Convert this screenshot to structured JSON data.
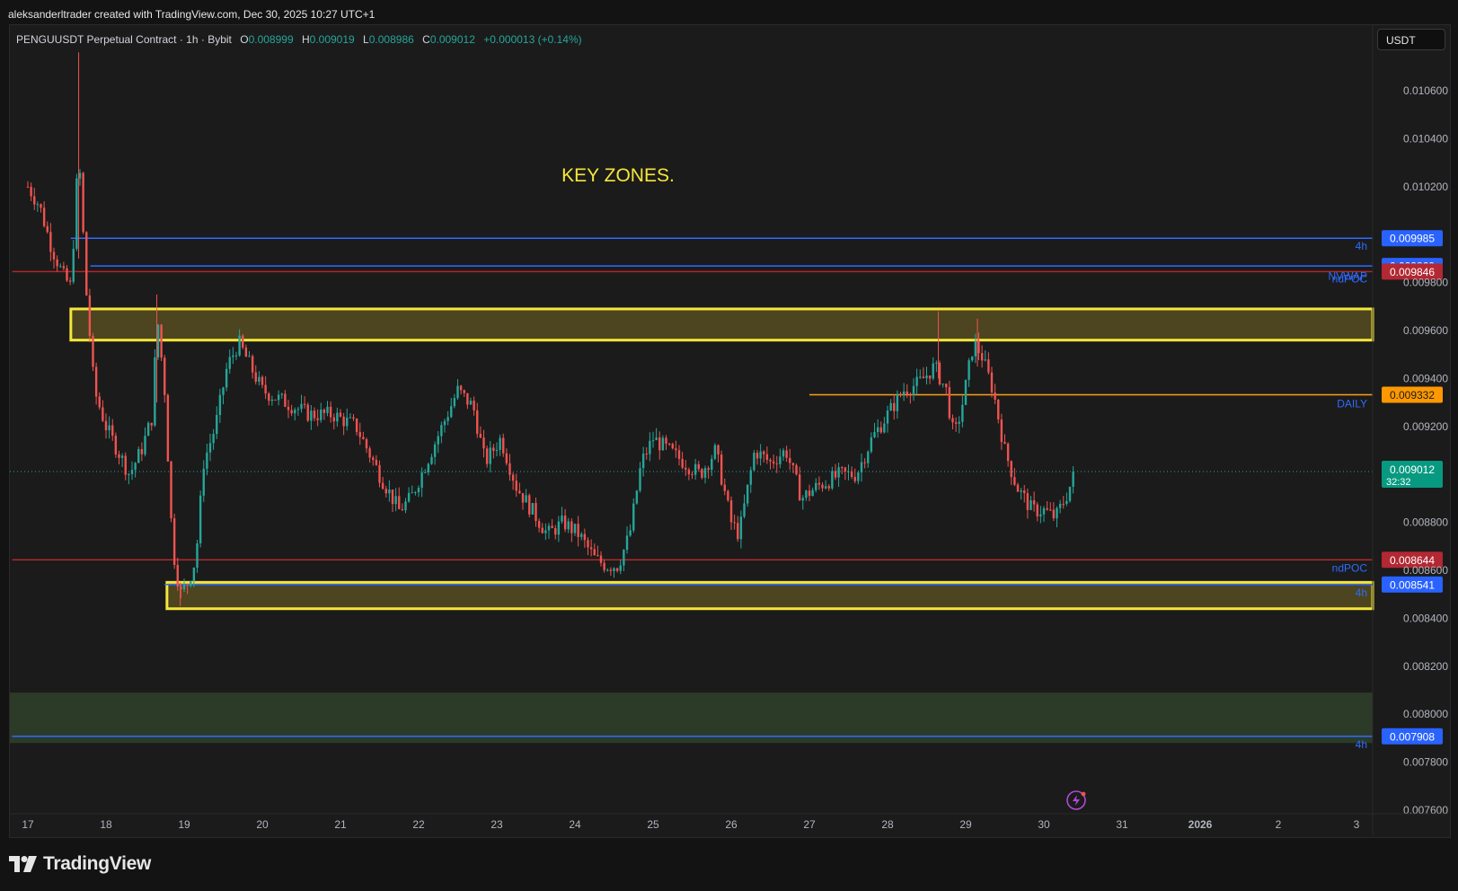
{
  "attribution": "aleksanderltrader created with TradingView.com, Dec 30, 2025 10:27 UTC+1",
  "legend": {
    "symbol": "PENGUUSDT Perpetual Contract · 1h · Bybit",
    "open_label": "O",
    "open": "0.008999",
    "high_label": "H",
    "high": "0.009019",
    "low_label": "L",
    "low": "0.008986",
    "close_label": "C",
    "close": "0.009012",
    "change": "+0.000013 (+0.14%)"
  },
  "currency_button": "USDT",
  "footer_brand": "TradingView",
  "colors": {
    "background": "#1b1b1b",
    "up": "#26a69a",
    "down": "#ef5350",
    "zone_yellow": "#f5e63a",
    "blue_line": "#2f6bff",
    "red_line": "#b2272b",
    "orange_line": "#ff9d1d",
    "green_zone": "#2b3b28"
  },
  "chart_data": {
    "type": "candlestick",
    "title": "KEY ZONES.",
    "x_ticks": [
      "17",
      "18",
      "19",
      "20",
      "21",
      "22",
      "23",
      "24",
      "25",
      "26",
      "27",
      "28",
      "29",
      "30",
      "31",
      "2026",
      "2",
      "3"
    ],
    "y_ticks": [
      "0.010600",
      "0.010400",
      "0.010200",
      "0.009800",
      "0.009600",
      "0.009400",
      "0.009200",
      "0.008800",
      "0.008600",
      "0.008400",
      "0.008200",
      "0.008000",
      "0.007800",
      "0.007600"
    ],
    "y_range": [
      0.00756,
      0.01074
    ],
    "x_range_days": [
      16.8,
      34.2
    ],
    "grid": false,
    "price_series_path": [
      [
        17.0,
        0.0102
      ],
      [
        17.15,
        0.01012
      ],
      [
        17.3,
        0.00995
      ],
      [
        17.45,
        0.00983
      ],
      [
        17.55,
        0.00978
      ],
      [
        17.65,
        0.01035
      ],
      [
        17.75,
        0.00975
      ],
      [
        17.85,
        0.00935
      ],
      [
        18.0,
        0.0092
      ],
      [
        18.15,
        0.0091
      ],
      [
        18.3,
        0.009
      ],
      [
        18.45,
        0.0091
      ],
      [
        18.6,
        0.00925
      ],
      [
        18.65,
        0.00968
      ],
      [
        18.75,
        0.00935
      ],
      [
        18.85,
        0.0087
      ],
      [
        18.95,
        0.0085
      ],
      [
        19.05,
        0.00855
      ],
      [
        19.15,
        0.00865
      ],
      [
        19.25,
        0.00905
      ],
      [
        19.4,
        0.0092
      ],
      [
        19.55,
        0.00945
      ],
      [
        19.7,
        0.00955
      ],
      [
        19.85,
        0.00945
      ],
      [
        20.0,
        0.00935
      ],
      [
        20.3,
        0.0093
      ],
      [
        20.6,
        0.00925
      ],
      [
        20.9,
        0.00925
      ],
      [
        21.2,
        0.0092
      ],
      [
        21.5,
        0.009
      ],
      [
        21.75,
        0.00885
      ],
      [
        21.9,
        0.0089
      ],
      [
        22.1,
        0.00905
      ],
      [
        22.3,
        0.0092
      ],
      [
        22.5,
        0.00935
      ],
      [
        22.7,
        0.00928
      ],
      [
        22.85,
        0.00905
      ],
      [
        23.05,
        0.00915
      ],
      [
        23.25,
        0.00895
      ],
      [
        23.45,
        0.00885
      ],
      [
        23.65,
        0.00875
      ],
      [
        23.85,
        0.0088
      ],
      [
        24.05,
        0.00875
      ],
      [
        24.25,
        0.00865
      ],
      [
        24.4,
        0.00862
      ],
      [
        24.55,
        0.00862
      ],
      [
        24.7,
        0.00875
      ],
      [
        24.85,
        0.00905
      ],
      [
        25.0,
        0.00915
      ],
      [
        25.2,
        0.0091
      ],
      [
        25.4,
        0.00905
      ],
      [
        25.6,
        0.009
      ],
      [
        25.8,
        0.0091
      ],
      [
        26.0,
        0.0088
      ],
      [
        26.1,
        0.00875
      ],
      [
        26.3,
        0.0091
      ],
      [
        26.5,
        0.00905
      ],
      [
        26.7,
        0.0091
      ],
      [
        26.9,
        0.0089
      ],
      [
        27.1,
        0.00895
      ],
      [
        27.4,
        0.009
      ],
      [
        27.6,
        0.009
      ],
      [
        27.8,
        0.00915
      ],
      [
        28.0,
        0.00925
      ],
      [
        28.2,
        0.00935
      ],
      [
        28.4,
        0.00938
      ],
      [
        28.6,
        0.00945
      ],
      [
        28.75,
        0.00935
      ],
      [
        28.85,
        0.00915
      ],
      [
        28.95,
        0.00928
      ],
      [
        29.1,
        0.00955
      ],
      [
        29.2,
        0.0095
      ],
      [
        29.35,
        0.00935
      ],
      [
        29.5,
        0.0091
      ],
      [
        29.65,
        0.00895
      ],
      [
        29.85,
        0.00885
      ],
      [
        30.0,
        0.00885
      ],
      [
        30.15,
        0.00882
      ],
      [
        30.3,
        0.00892
      ],
      [
        30.4,
        0.00901
      ]
    ],
    "zones": [
      {
        "kind": "yellow",
        "from_day": 17.55,
        "top": 0.00969,
        "bottom": 0.00956
      },
      {
        "kind": "yellow",
        "from_day": 18.78,
        "top": 0.00855,
        "bottom": 0.00844
      },
      {
        "kind": "green",
        "from_day": 16.8,
        "top": 0.00809,
        "bottom": 0.00788
      }
    ],
    "lines": [
      {
        "price": 0.009985,
        "from_day": 17.55,
        "color": "blue",
        "label": "4h",
        "badge": "0.009985"
      },
      {
        "price": 0.009869,
        "from_day": 17.8,
        "color": "blue",
        "label": "",
        "badge": "0.009869"
      },
      {
        "price": 0.009846,
        "from_day": 16.8,
        "color": "red",
        "label": "NVWAP",
        "badge": "0.009846"
      },
      {
        "price": 0.009332,
        "from_day": 27.0,
        "color": "orange",
        "label": "DAILY",
        "badge": "0.009332"
      },
      {
        "price": 0.008644,
        "from_day": 16.8,
        "color": "red",
        "label": "ndPOC",
        "badge": "0.008644"
      },
      {
        "price": 0.008541,
        "from_day": 18.75,
        "color": "blue",
        "label": "4h",
        "badge": "0.008541"
      },
      {
        "price": 0.007908,
        "from_day": 16.8,
        "color": "blue",
        "label": "4h",
        "badge": "0.007908"
      }
    ],
    "extra_labels": [
      {
        "text": "ndPOC",
        "price": 0.009815,
        "color": "blue"
      }
    ],
    "current_price": {
      "price": 0.009012,
      "badge": "0.009012",
      "countdown": "32:32"
    }
  }
}
